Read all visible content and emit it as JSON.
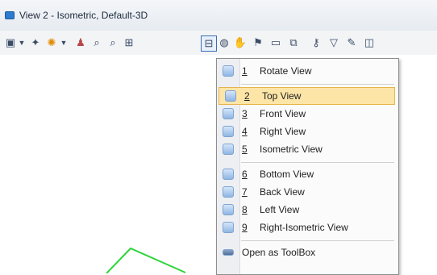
{
  "window": {
    "title": "View 2 - Isometric, Default-3D"
  },
  "toolbar": {
    "icons": [
      "view-dropdown-icon",
      "caret-icon",
      "camera-icon",
      "lighting-icon",
      "caret-icon",
      "people-icon",
      "zoom-in-icon",
      "zoom-out-icon",
      "fit-view-icon",
      "view-layout-icon",
      "rotate-view-icon",
      "pan-icon",
      "walk-icon",
      "window-area-icon",
      "copy-view-icon",
      "named-view-icon",
      "tools-icon",
      "extra-icon"
    ]
  },
  "menu": {
    "items": [
      {
        "num": "1",
        "label": "Rotate View",
        "icon": "rotate-view-icon"
      },
      {
        "num": "2",
        "label": "Top View",
        "icon": "top-view-icon",
        "highlighted": true
      },
      {
        "num": "3",
        "label": "Front View",
        "icon": "front-view-icon"
      },
      {
        "num": "4",
        "label": "Right View",
        "icon": "right-view-icon"
      },
      {
        "num": "5",
        "label": "Isometric View",
        "icon": "isometric-view-icon"
      },
      {
        "num": "6",
        "label": "Bottom View",
        "icon": "bottom-view-icon"
      },
      {
        "num": "7",
        "label": "Back View",
        "icon": "back-view-icon"
      },
      {
        "num": "8",
        "label": "Left View",
        "icon": "left-view-icon"
      },
      {
        "num": "9",
        "label": "Right-Isometric View",
        "icon": "right-isometric-view-icon"
      },
      {
        "num": "",
        "label": "Open as ToolBox",
        "icon": "toolbox-icon"
      }
    ]
  },
  "colors": {
    "highlight": "#fde5a8",
    "highlight_border": "#e6b44a",
    "green_line": "#2fd43a"
  }
}
